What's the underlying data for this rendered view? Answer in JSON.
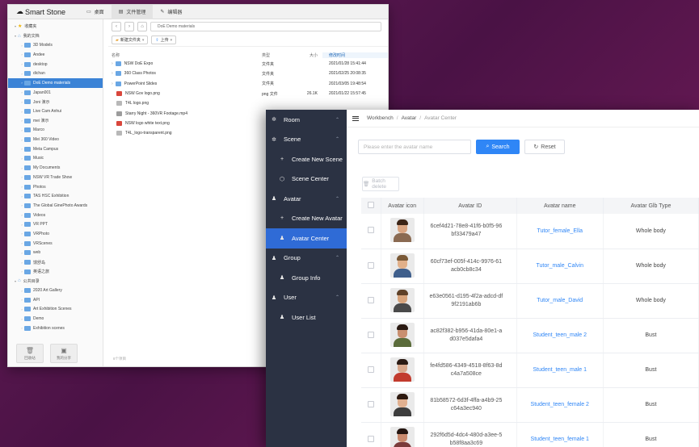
{
  "file_manager": {
    "brand": "Smart Stone",
    "tabs": [
      {
        "label": "桌面",
        "icon": "monitor-icon"
      },
      {
        "label": "文件管理",
        "icon": "folder-icon"
      },
      {
        "label": "编辑器",
        "icon": "edit-icon"
      }
    ],
    "tree": [
      {
        "label": "收藏夹",
        "level": 0,
        "type": "star"
      },
      {
        "label": "我的文档",
        "level": 0,
        "type": "root"
      },
      {
        "label": "3D Models",
        "level": 1,
        "type": "folder"
      },
      {
        "label": "Andee",
        "level": 1,
        "type": "folder"
      },
      {
        "label": "desktop",
        "level": 1,
        "type": "folder"
      },
      {
        "label": "dichan",
        "level": 1,
        "type": "folder"
      },
      {
        "label": "DoE Demo materials",
        "level": 1,
        "type": "folder",
        "selected": true
      },
      {
        "label": "Japan001",
        "level": 1,
        "type": "folder"
      },
      {
        "label": "Joni 演示",
        "level": 1,
        "type": "folder"
      },
      {
        "label": "Live Cam Anhui",
        "level": 1,
        "type": "folder"
      },
      {
        "label": "mei 演示",
        "level": 1,
        "type": "folder"
      },
      {
        "label": "Marco",
        "level": 1,
        "type": "folder"
      },
      {
        "label": "Mei 360 Video",
        "level": 1,
        "type": "folder"
      },
      {
        "label": "Meta Campus",
        "level": 1,
        "type": "folder"
      },
      {
        "label": "Music",
        "level": 1,
        "type": "folder"
      },
      {
        "label": "My Documents",
        "level": 1,
        "type": "folder"
      },
      {
        "label": "NSW VR Trade Show",
        "level": 1,
        "type": "folder"
      },
      {
        "label": "Photos",
        "level": 1,
        "type": "folder"
      },
      {
        "label": "TAS HSC Exhibition",
        "level": 1,
        "type": "folder"
      },
      {
        "label": "The Global GinePhoto Awards",
        "level": 1,
        "type": "folder"
      },
      {
        "label": "Videos",
        "level": 1,
        "type": "folder"
      },
      {
        "label": "VR PPT",
        "level": 1,
        "type": "folder"
      },
      {
        "label": "VRPhoto",
        "level": 1,
        "type": "folder"
      },
      {
        "label": "VRScenes",
        "level": 1,
        "type": "folder"
      },
      {
        "label": "web",
        "level": 1,
        "type": "folder"
      },
      {
        "label": "馒舒岛",
        "level": 1,
        "type": "folder"
      },
      {
        "label": "英语之旅",
        "level": 1,
        "type": "folder"
      },
      {
        "label": "公共目录",
        "level": 0,
        "type": "root"
      },
      {
        "label": "2020 Art Gallery",
        "level": 1,
        "type": "folder"
      },
      {
        "label": "API",
        "level": 1,
        "type": "folder"
      },
      {
        "label": "Art Exhibition Scenes",
        "level": 1,
        "type": "folder"
      },
      {
        "label": "Demo",
        "level": 1,
        "type": "folder"
      },
      {
        "label": "Exhibition scenes",
        "level": 1,
        "type": "folder"
      }
    ],
    "sidebar_buttons": [
      {
        "label": "回收站",
        "icon": "trash-icon"
      },
      {
        "label": "我的分享",
        "icon": "image-icon"
      }
    ],
    "path": "DoE Demo materials",
    "actions": [
      {
        "label": "新建文件夹",
        "icon": "new-folder-icon"
      },
      {
        "label": "上传",
        "icon": "upload-icon"
      }
    ],
    "columns": {
      "name": "名称",
      "type": "类型",
      "size": "大小",
      "date": "修改时间"
    },
    "files": [
      {
        "name": "NSW DoE Expo",
        "type": "文件夹",
        "size": "",
        "date": "2021/01/28 15:41:44",
        "kind": "folder"
      },
      {
        "name": "360 Class Photos",
        "type": "文件夹",
        "size": "",
        "date": "2021/02/25 20:08:35",
        "kind": "folder"
      },
      {
        "name": "PowerPoint Slides",
        "type": "文件夹",
        "size": "",
        "date": "2021/03/05 19:48:54",
        "kind": "folder"
      },
      {
        "name": "NSW Gov logo.png",
        "type": "png 文件",
        "size": "26.1K",
        "date": "2021/01/22 15:57:45",
        "kind": "image-red"
      },
      {
        "name": "T4L logo.png",
        "type": "",
        "size": "",
        "date": "",
        "kind": "image"
      },
      {
        "name": "Starry Night - 360VR Footage.mp4",
        "type": "",
        "size": "",
        "date": "",
        "kind": "video"
      },
      {
        "name": "NSW logo white text.png",
        "type": "",
        "size": "",
        "date": "",
        "kind": "image-red"
      },
      {
        "name": "T4L_logo-transparent.png",
        "type": "",
        "size": "",
        "date": "",
        "kind": "image"
      }
    ],
    "count": "8个项目"
  },
  "admin": {
    "nav": [
      {
        "label": "Room",
        "icon": "gear-icon",
        "kind": "group",
        "caret": true
      },
      {
        "label": "Scene",
        "icon": "gear-icon",
        "kind": "group",
        "caret": true
      },
      {
        "label": "Create New Scene",
        "icon": "plus-icon",
        "kind": "sub"
      },
      {
        "label": "Scene Center",
        "icon": "cube-icon",
        "kind": "sub"
      },
      {
        "label": "Avatar",
        "icon": "user-icon",
        "kind": "group",
        "caret": true
      },
      {
        "label": "Create New Avatar",
        "icon": "plus-icon",
        "kind": "sub"
      },
      {
        "label": "Avatar Center",
        "icon": "user-icon",
        "kind": "sub",
        "active": true
      },
      {
        "label": "Group",
        "icon": "group-icon",
        "kind": "group",
        "caret": true
      },
      {
        "label": "Group Info",
        "icon": "group-icon",
        "kind": "sub"
      },
      {
        "label": "User",
        "icon": "user-icon",
        "kind": "group",
        "caret": true
      },
      {
        "label": "User List",
        "icon": "user-icon",
        "kind": "sub"
      }
    ],
    "breadcrumb": [
      "Workbench",
      "Avatar",
      "Avatar Center"
    ],
    "search": {
      "placeholder": "Please enter the avatar name",
      "value": ""
    },
    "buttons": {
      "search": "Search",
      "reset": "Reset",
      "batch_delete": "Batch delete"
    },
    "table": {
      "headers": [
        "Avatar icon",
        "Avatar ID",
        "Avatar name",
        "Avatar Glb Type"
      ],
      "rows": [
        {
          "id": "6cef4d21-78e8-41f6-b0f5-96bf33479a47",
          "name": "Tutor_female_Ella",
          "type": "Whole body",
          "skin": "#d9a582",
          "hair": "#3b2416",
          "shirt": "#8a6a52"
        },
        {
          "id": "60cf73ef-005f-414c-9976-61acb0cb8c34",
          "name": "Tutor_male_Calvin",
          "type": "Whole body",
          "skin": "#e1b08a",
          "hair": "#7b5a37",
          "shirt": "#3f5f8c"
        },
        {
          "id": "e63e0561-d195-4f2a-adcd-df9f2191ab6b",
          "name": "Tutor_male_David",
          "type": "Whole body",
          "skin": "#d7a47c",
          "hair": "#5e4128",
          "shirt": "#4a4a4a"
        },
        {
          "id": "ac82f382-b956-41da-80e1-ad037e5dafa4",
          "name": "Student_teen_male 2",
          "type": "Bust",
          "skin": "#c98f70",
          "hair": "#2a1a12",
          "shirt": "#5a6b3a"
        },
        {
          "id": "fe4fd586-4349-4518-8f63-8dc4a7a508ce",
          "name": "Student_teen_male 1",
          "type": "Bust",
          "skin": "#d8a88c",
          "hair": "#2b1b14",
          "shirt": "#c23b2e"
        },
        {
          "id": "81b58572-6d3f-4ffa-a4b9-25c64a3ec940",
          "name": "Student_teen_female 2",
          "type": "Bust",
          "skin": "#e0b090",
          "hair": "#2e1a10",
          "shirt": "#3d3d3d"
        },
        {
          "id": "292f6d5d-4dc4-480d-a3ee-5b58f8aa3c69",
          "name": "Student_teen_female 1",
          "type": "Bust",
          "skin": "#c98a6e",
          "hair": "#241510",
          "shirt": "#7a3b3b"
        }
      ]
    }
  }
}
